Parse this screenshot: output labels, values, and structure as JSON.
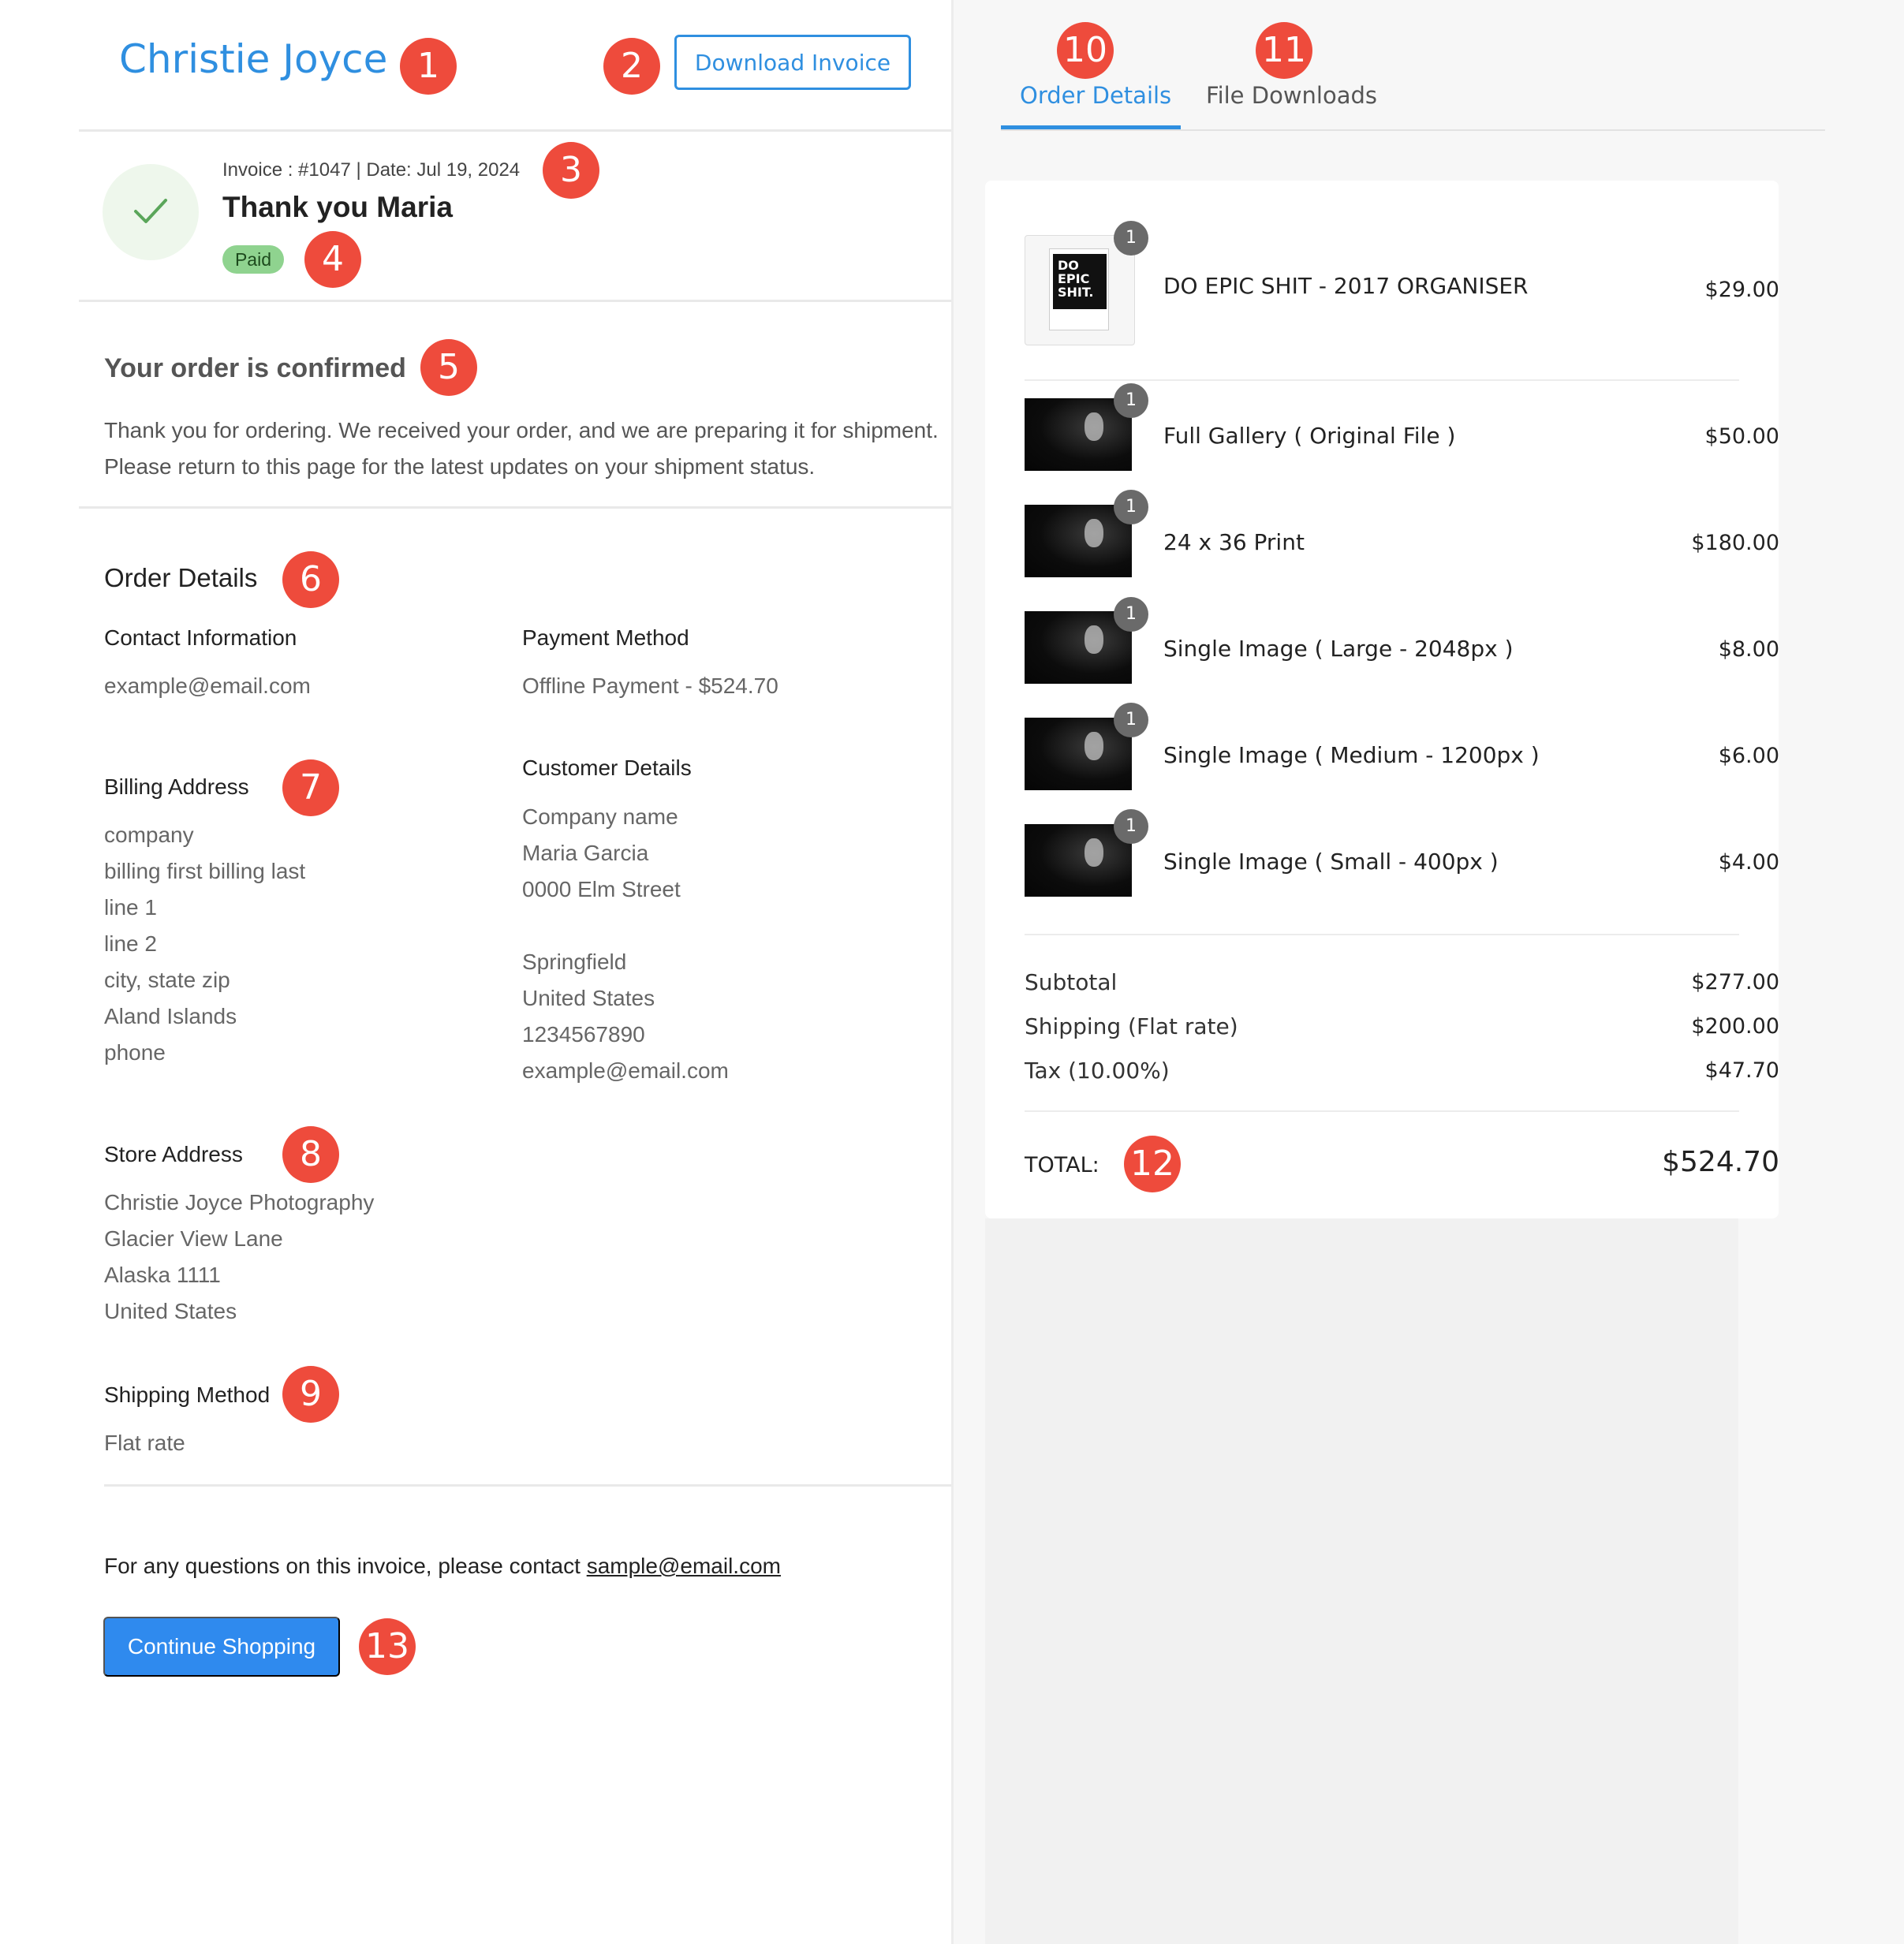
{
  "header": {
    "brand": "Christie Joyce",
    "download_label": "Download Invoice"
  },
  "status": {
    "invoice_meta": "Invoice : #1047 | Date: Jul 19, 2024",
    "thanks": "Thank you Maria",
    "paid_badge": "Paid"
  },
  "confirmation": {
    "title": "Your order is confirmed",
    "message": "Thank you for ordering. We received your order, and we are preparing it for shipment. Please return to this page for the latest updates on your shipment status."
  },
  "order_details": {
    "title": "Order Details",
    "contact_label": "Contact Information",
    "contact_email": "example@email.com",
    "payment_label": "Payment Method",
    "payment_value": "Offline Payment - $524.70",
    "billing_label": "Billing Address",
    "billing_lines": [
      "company",
      "billing first billing last",
      "line 1",
      "line 2",
      "city, state zip",
      "Aland Islands",
      "phone"
    ],
    "customer_label": "Customer Details",
    "customer_lines": [
      "Company name",
      "Maria Garcia",
      "0000 Elm Street",
      "",
      "Springfield",
      "United States",
      "1234567890",
      "example@email.com"
    ],
    "store_label": "Store Address",
    "store_lines": [
      "Christie Joyce Photography",
      "Glacier View Lane",
      "Alaska 1111",
      "United States"
    ],
    "shipping_label": "Shipping Method",
    "shipping_value": "Flat rate"
  },
  "footer": {
    "question_text": "For any questions on this invoice, please contact",
    "contact_link": "sample@email.com",
    "continue_label": "Continue Shopping"
  },
  "tabs": [
    {
      "label": "Order Details",
      "active": true
    },
    {
      "label": "File Downloads",
      "active": false
    }
  ],
  "book_cover_text": [
    "DO",
    "EPIC",
    "SHIT."
  ],
  "items": [
    {
      "qty": "1",
      "name": "DO EPIC SHIT - 2017 ORGANISER",
      "price": "$29.00",
      "thumb": "book"
    },
    {
      "qty": "1",
      "name": "Full Gallery ( Original File )",
      "price": "$50.00",
      "thumb": "photo"
    },
    {
      "qty": "1",
      "name": "24 x 36 Print",
      "price": "$180.00",
      "thumb": "photo"
    },
    {
      "qty": "1",
      "name": "Single Image ( Large - 2048px )",
      "price": "$8.00",
      "thumb": "photo"
    },
    {
      "qty": "1",
      "name": "Single Image ( Medium - 1200px )",
      "price": "$6.00",
      "thumb": "photo"
    },
    {
      "qty": "1",
      "name": "Single Image ( Small - 400px )",
      "price": "$4.00",
      "thumb": "photo"
    }
  ],
  "summary": {
    "subtotal_label": "Subtotal",
    "subtotal_value": "$277.00",
    "shipping_label": "Shipping (Flat rate)",
    "shipping_value": "$200.00",
    "tax_label": "Tax (10.00%)",
    "tax_value": "$47.70",
    "total_label": "TOTAL:",
    "total_value": "$524.70"
  },
  "markers": [
    "1",
    "2",
    "3",
    "4",
    "5",
    "6",
    "7",
    "8",
    "9",
    "10",
    "11",
    "12",
    "13"
  ],
  "colors": {
    "accent": "#2f8fe0",
    "marker": "#ee4b3c",
    "paid_badge": "#8fd38f",
    "primary_button": "#2f8aee"
  }
}
